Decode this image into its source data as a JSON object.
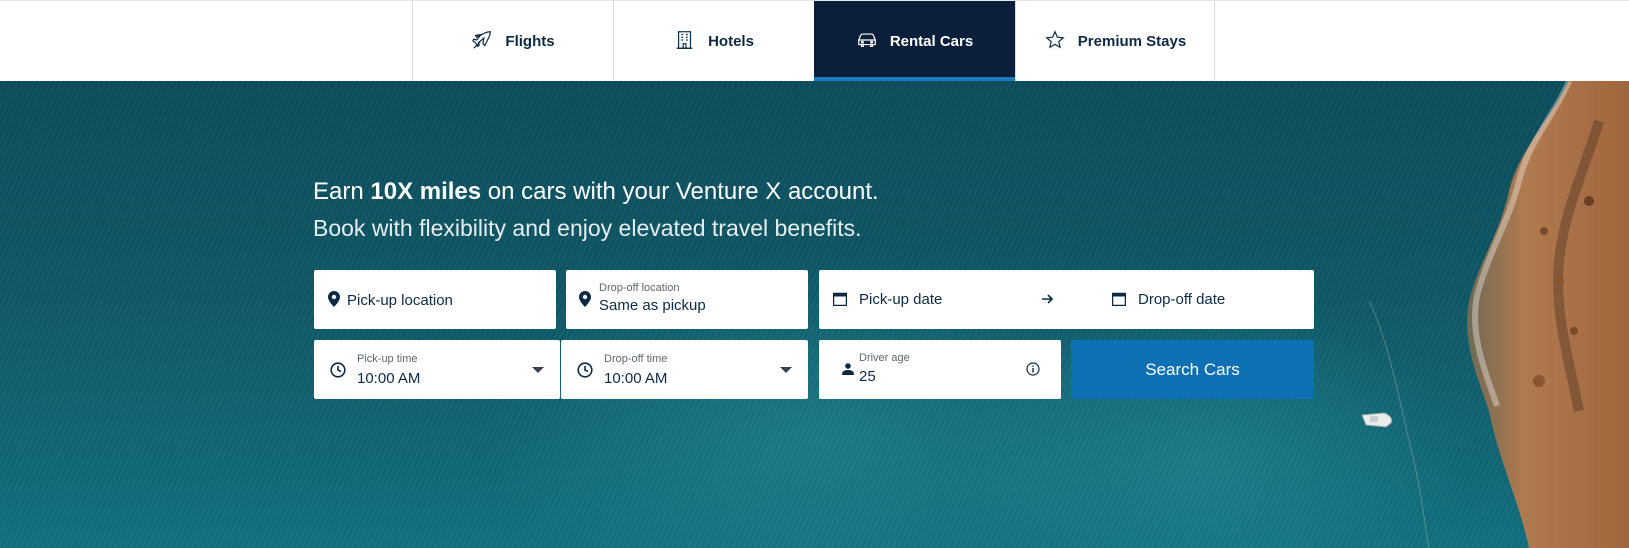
{
  "nav": {
    "tabs": [
      {
        "label": "Flights",
        "icon": "airplane-icon",
        "active": false
      },
      {
        "label": "Hotels",
        "icon": "hotel-building-icon",
        "active": false
      },
      {
        "label": "Rental Cars",
        "icon": "car-icon",
        "active": true
      },
      {
        "label": "Premium Stays",
        "icon": "star-icon",
        "active": false
      }
    ],
    "active_color": "#0b1f3a",
    "active_underline_color": "#1a7ac0"
  },
  "hero": {
    "headline_prefix": "Earn ",
    "headline_bold": "10X miles",
    "headline_suffix": " on cars with your Venture X account.",
    "subline": "Book with flexibility and enjoy elevated travel benefits."
  },
  "form": {
    "pickup_location": {
      "placeholder": "Pick-up location",
      "icon": "location-pin-icon"
    },
    "dropoff_location": {
      "label": "Drop-off location",
      "value": "Same as pickup",
      "icon": "location-pin-icon"
    },
    "pickup_date": {
      "placeholder": "Pick-up date",
      "icon": "calendar-icon"
    },
    "date_arrow": "arrow-right-icon",
    "dropoff_date": {
      "placeholder": "Drop-off date",
      "icon": "calendar-icon"
    },
    "pickup_time": {
      "label": "Pick-up time",
      "value": "10:00 AM",
      "icon": "clock-icon"
    },
    "dropoff_time": {
      "label": "Drop-off time",
      "value": "10:00 AM",
      "icon": "clock-icon"
    },
    "driver_age": {
      "label": "Driver age",
      "value": "25",
      "icon": "person-icon",
      "info_icon": "info-icon"
    },
    "search_button": "Search Cars",
    "search_button_color": "#0d70b2"
  }
}
